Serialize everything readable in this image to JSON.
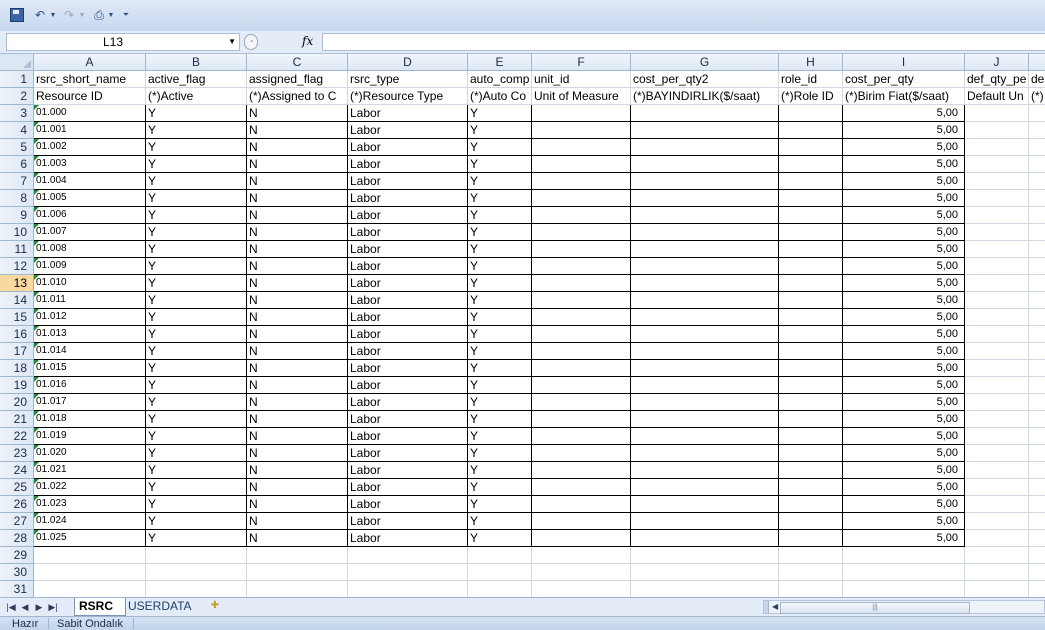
{
  "toolbar": {
    "icons": [
      "save-icon",
      "undo-icon",
      "redo-icon",
      "print-preview-icon",
      "customize-icon"
    ],
    "undo_glyph": "↶",
    "redo_glyph": "↷",
    "preview_glyph": "🔍"
  },
  "formula_bar": {
    "name_box": "L13",
    "fx_label": "fx",
    "formula": ""
  },
  "columns": [
    {
      "letter": "A"
    },
    {
      "letter": "B"
    },
    {
      "letter": "C"
    },
    {
      "letter": "D"
    },
    {
      "letter": "E"
    },
    {
      "letter": "F"
    },
    {
      "letter": "G"
    },
    {
      "letter": "H"
    },
    {
      "letter": "I"
    },
    {
      "letter": "J"
    }
  ],
  "row_numbers": [
    1,
    2,
    3,
    4,
    5,
    6,
    7,
    8,
    9,
    10,
    11,
    12,
    13,
    14,
    15,
    16,
    17,
    18,
    19,
    20,
    21,
    22,
    23,
    24,
    25,
    26,
    27,
    28,
    29,
    30,
    31
  ],
  "selected_row": 13,
  "header_row1": [
    "rsrc_short_name",
    "active_flag",
    "assigned_flag",
    "rsrc_type",
    "auto_comp",
    "unit_id",
    "cost_per_qty2",
    "role_id",
    "cost_per_qty",
    "def_qty_pe",
    "de"
  ],
  "header_row2": [
    "Resource ID",
    "(*)Active",
    "(*)Assigned to C",
    "(*)Resource Type",
    "(*)Auto Co",
    "Unit of Measure",
    "(*)BAYINDIRLIK($/saat)",
    "(*)Role ID",
    "(*)Birim Fiat($/saat)",
    "Default Un",
    "(*)"
  ],
  "resources": [
    {
      "id": "01.000",
      "active": "Y",
      "assigned": "N",
      "type": "Labor",
      "auto": "Y",
      "cost": "5,00"
    },
    {
      "id": "01.001",
      "active": "Y",
      "assigned": "N",
      "type": "Labor",
      "auto": "Y",
      "cost": "5,00"
    },
    {
      "id": "01.002",
      "active": "Y",
      "assigned": "N",
      "type": "Labor",
      "auto": "Y",
      "cost": "5,00"
    },
    {
      "id": "01.003",
      "active": "Y",
      "assigned": "N",
      "type": "Labor",
      "auto": "Y",
      "cost": "5,00"
    },
    {
      "id": "01.004",
      "active": "Y",
      "assigned": "N",
      "type": "Labor",
      "auto": "Y",
      "cost": "5,00"
    },
    {
      "id": "01.005",
      "active": "Y",
      "assigned": "N",
      "type": "Labor",
      "auto": "Y",
      "cost": "5,00"
    },
    {
      "id": "01.006",
      "active": "Y",
      "assigned": "N",
      "type": "Labor",
      "auto": "Y",
      "cost": "5,00"
    },
    {
      "id": "01.007",
      "active": "Y",
      "assigned": "N",
      "type": "Labor",
      "auto": "Y",
      "cost": "5,00"
    },
    {
      "id": "01.008",
      "active": "Y",
      "assigned": "N",
      "type": "Labor",
      "auto": "Y",
      "cost": "5,00"
    },
    {
      "id": "01.009",
      "active": "Y",
      "assigned": "N",
      "type": "Labor",
      "auto": "Y",
      "cost": "5,00"
    },
    {
      "id": "01.010",
      "active": "Y",
      "assigned": "N",
      "type": "Labor",
      "auto": "Y",
      "cost": "5,00"
    },
    {
      "id": "01.011",
      "active": "Y",
      "assigned": "N",
      "type": "Labor",
      "auto": "Y",
      "cost": "5,00"
    },
    {
      "id": "01.012",
      "active": "Y",
      "assigned": "N",
      "type": "Labor",
      "auto": "Y",
      "cost": "5,00"
    },
    {
      "id": "01.013",
      "active": "Y",
      "assigned": "N",
      "type": "Labor",
      "auto": "Y",
      "cost": "5,00"
    },
    {
      "id": "01.014",
      "active": "Y",
      "assigned": "N",
      "type": "Labor",
      "auto": "Y",
      "cost": "5,00"
    },
    {
      "id": "01.015",
      "active": "Y",
      "assigned": "N",
      "type": "Labor",
      "auto": "Y",
      "cost": "5,00"
    },
    {
      "id": "01.016",
      "active": "Y",
      "assigned": "N",
      "type": "Labor",
      "auto": "Y",
      "cost": "5,00"
    },
    {
      "id": "01.017",
      "active": "Y",
      "assigned": "N",
      "type": "Labor",
      "auto": "Y",
      "cost": "5,00"
    },
    {
      "id": "01.018",
      "active": "Y",
      "assigned": "N",
      "type": "Labor",
      "auto": "Y",
      "cost": "5,00"
    },
    {
      "id": "01.019",
      "active": "Y",
      "assigned": "N",
      "type": "Labor",
      "auto": "Y",
      "cost": "5,00"
    },
    {
      "id": "01.020",
      "active": "Y",
      "assigned": "N",
      "type": "Labor",
      "auto": "Y",
      "cost": "5,00"
    },
    {
      "id": "01.021",
      "active": "Y",
      "assigned": "N",
      "type": "Labor",
      "auto": "Y",
      "cost": "5,00"
    },
    {
      "id": "01.022",
      "active": "Y",
      "assigned": "N",
      "type": "Labor",
      "auto": "Y",
      "cost": "5,00"
    },
    {
      "id": "01.023",
      "active": "Y",
      "assigned": "N",
      "type": "Labor",
      "auto": "Y",
      "cost": "5,00"
    },
    {
      "id": "01.024",
      "active": "Y",
      "assigned": "N",
      "type": "Labor",
      "auto": "Y",
      "cost": "5,00"
    },
    {
      "id": "01.025",
      "active": "Y",
      "assigned": "N",
      "type": "Labor",
      "auto": "Y",
      "cost": "5,00"
    }
  ],
  "sheet_tabs": {
    "nav_glyphs": [
      "|◀",
      "◀",
      "▶",
      "▶|"
    ],
    "active": "RSRC",
    "inactive": "USERDATA",
    "insert_glyph": "✚"
  },
  "status_bar": {
    "ready": "Hazır",
    "mode": "Sabit Ondalık"
  }
}
